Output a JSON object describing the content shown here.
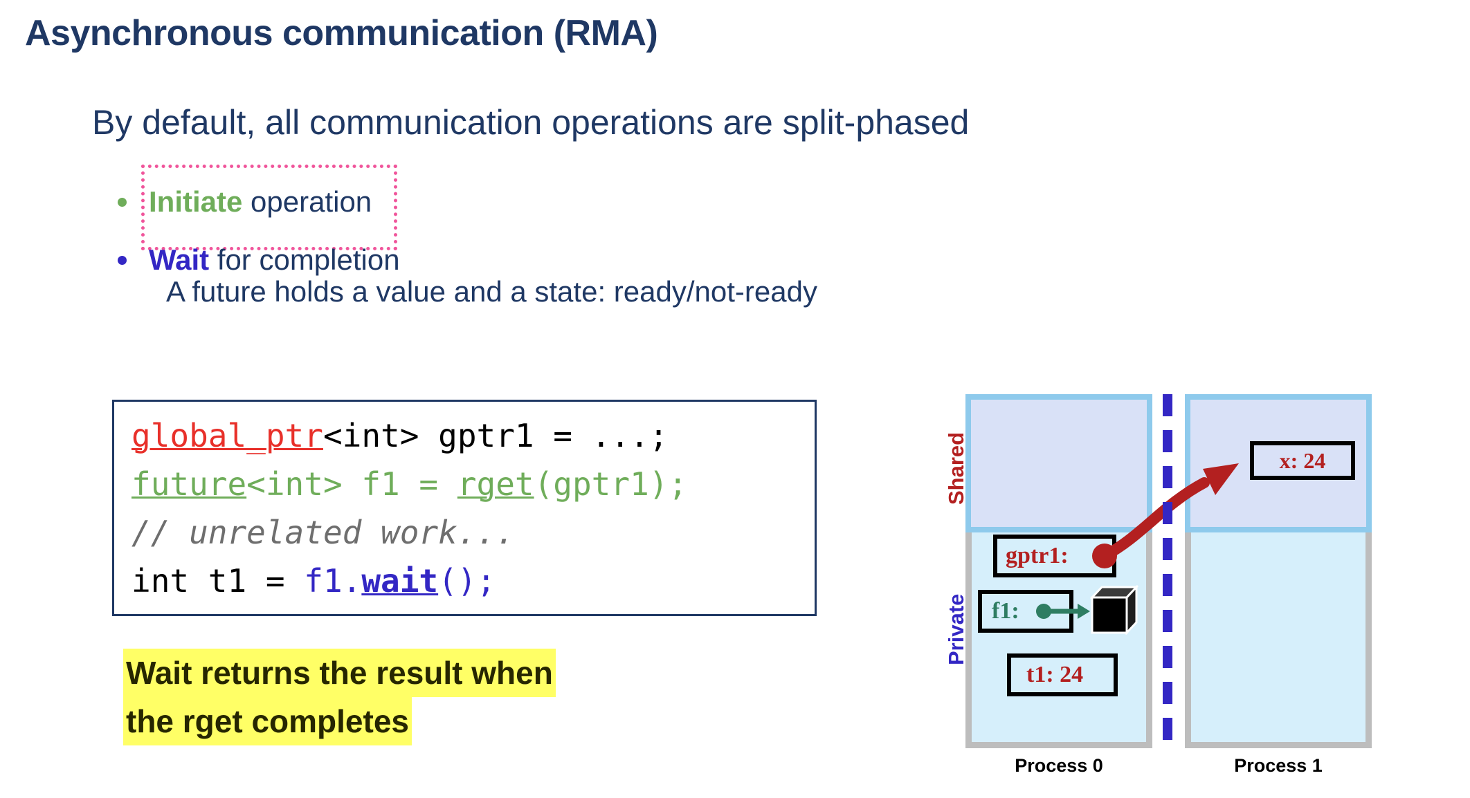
{
  "slide": {
    "title": "Asynchronous communication (RMA)",
    "lead": "By default, all communication operations are split-phased",
    "sub_note": "A future holds a value and a state: ready/not-ready"
  },
  "bullets": [
    {
      "keyword": "Initiate",
      "rest": " operation",
      "dot_color": "#6FAD5A",
      "keyword_color": "#6FAD5A"
    },
    {
      "keyword": "Wait",
      "rest": " for completion",
      "dot_color": "#3327C4",
      "keyword_color": "#3327C4"
    }
  ],
  "code": {
    "line1": {
      "kw": "global_ptr",
      "rest": "<int> gptr1 = ...;"
    },
    "line2": {
      "a": "future",
      "b": "<int> f1 = ",
      "c": "rget",
      "d": "(gptr1);"
    },
    "line3": {
      "comment": "// unrelated work..."
    },
    "line4": {
      "a": "int t1 = ",
      "b": "f1.",
      "c": "wait",
      "d": "();"
    }
  },
  "callout": {
    "line1": "Wait returns the result when",
    "line2": "the rget completes",
    "highlight_color": "#FFFF66"
  },
  "diagram": {
    "side_labels": {
      "shared": "Shared",
      "private": "Private"
    },
    "process0": {
      "caption": "Process 0",
      "gptr1": "gptr1:",
      "f1": "f1:",
      "t1": "t1: 24"
    },
    "process1": {
      "caption": "Process 1",
      "x": "x: 24"
    },
    "colors": {
      "shared_fill": "#D9E1F7",
      "shared_frame": "#8ECAEC",
      "private_fill": "#D6EFFB",
      "private_frame": "#BDBDBD",
      "arrow": "#B32020",
      "divider": "#3327C4",
      "shared_label": "#B32020",
      "private_label": "#3327C4",
      "future_green": "#2E7D62"
    }
  }
}
